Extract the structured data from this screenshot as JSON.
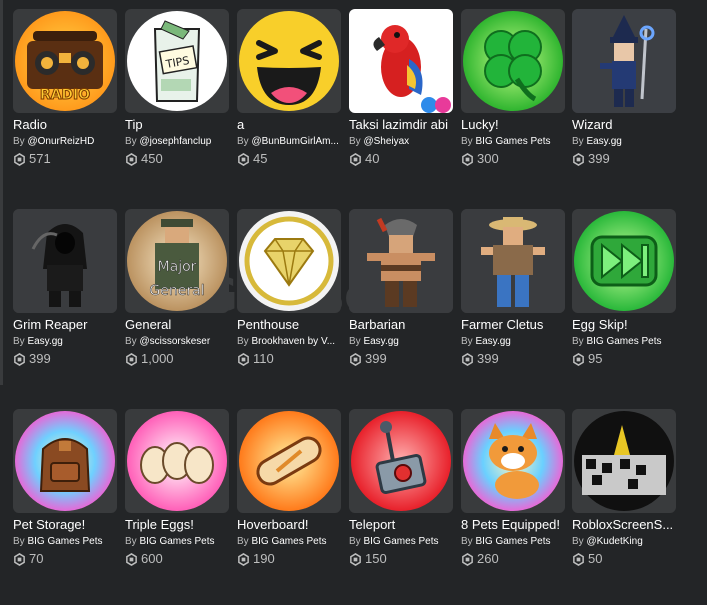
{
  "items": [
    {
      "name": "Radio",
      "creator": "@OnurReizHD",
      "price": "571",
      "icon": "radio-boombox-icon"
    },
    {
      "name": "Tip",
      "creator": "@josephfanclup",
      "price": "450",
      "icon": "tips-jar-icon"
    },
    {
      "name": "a",
      "creator": "@BunBumGirlAm...",
      "price": "45",
      "icon": "laughing-face-icon"
    },
    {
      "name": "Taksi lazimdir abi",
      "creator": "@Sheiyax",
      "price": "40",
      "icon": "red-parrot-icon"
    },
    {
      "name": "Lucky!",
      "creator": "BIG Games Pets",
      "price": "300",
      "icon": "clover-icon"
    },
    {
      "name": "Wizard",
      "creator": "Easy.gg",
      "price": "399",
      "icon": "wizard-avatar-icon"
    },
    {
      "name": "Grim Reaper",
      "creator": "Easy.gg",
      "price": "399",
      "icon": "grim-reaper-avatar-icon"
    },
    {
      "name": "General",
      "creator": "@scissorskeser",
      "price": "1,000",
      "icon": "major-general-avatar-icon"
    },
    {
      "name": "Penthouse",
      "creator": "Brookhaven by V...",
      "price": "110",
      "icon": "diamond-icon"
    },
    {
      "name": "Barbarian",
      "creator": "Easy.gg",
      "price": "399",
      "icon": "barbarian-avatar-icon"
    },
    {
      "name": "Farmer Cletus",
      "creator": "Easy.gg",
      "price": "399",
      "icon": "farmer-avatar-icon"
    },
    {
      "name": "Egg Skip!",
      "creator": "BIG Games Pets",
      "price": "95",
      "icon": "fast-forward-icon"
    },
    {
      "name": "Pet Storage!",
      "creator": "BIG Games Pets",
      "price": "70",
      "icon": "backpack-icon"
    },
    {
      "name": "Triple Eggs!",
      "creator": "BIG Games Pets",
      "price": "600",
      "icon": "three-eggs-icon"
    },
    {
      "name": "Hoverboard!",
      "creator": "BIG Games Pets",
      "price": "190",
      "icon": "hoverboard-icon"
    },
    {
      "name": "Teleport",
      "creator": "BIG Games Pets",
      "price": "150",
      "icon": "teleport-joystick-icon"
    },
    {
      "name": "8 Pets Equipped!",
      "creator": "BIG Games Pets",
      "price": "260",
      "icon": "dog-pet-icon"
    },
    {
      "name": "RobloxScreenS...",
      "creator": "@KudetKing",
      "price": "50",
      "icon": "screenshot-icon"
    }
  ],
  "by_label": "By",
  "watermark_text": "Gamsoto"
}
